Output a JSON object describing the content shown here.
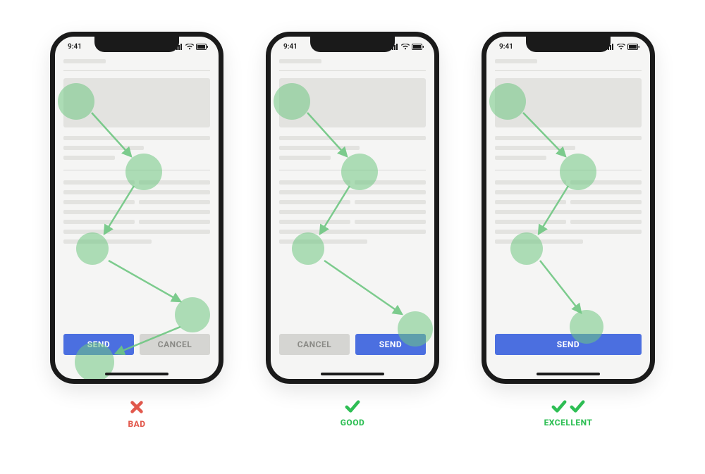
{
  "status_time": "9:41",
  "bad": {
    "primary_label": "SEND",
    "secondary_label": "CANCEL",
    "caption": "BAD"
  },
  "good": {
    "primary_label": "SEND",
    "secondary_label": "CANCEL",
    "caption": "GOOD"
  },
  "excellent": {
    "primary_label": "SEND",
    "caption": "EXCELLENT"
  },
  "colors": {
    "primary_button": "#4b6fe0",
    "secondary_button": "#d5d5d2",
    "accent_green": "#2fbf55",
    "accent_red": "#e2594d",
    "spot_green": "rgba(111,199,130,0.55)"
  }
}
